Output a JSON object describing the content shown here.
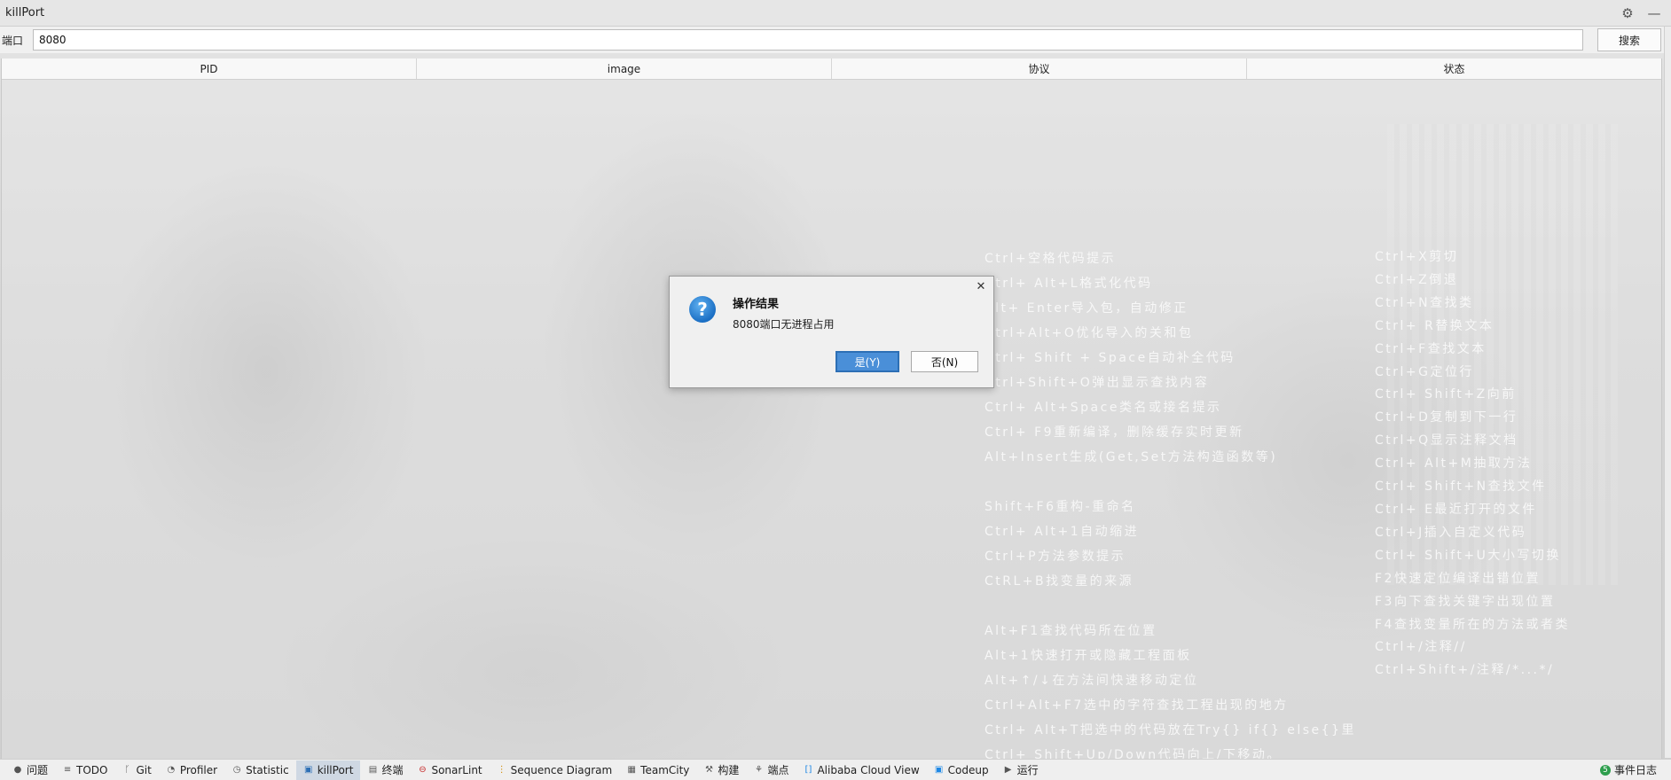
{
  "window": {
    "title": "killPort"
  },
  "titlebar_icons": [
    "gear-icon",
    "minimize-icon"
  ],
  "search": {
    "label": "端口",
    "value": "8080",
    "button": "搜索"
  },
  "table": {
    "columns": [
      "PID",
      "image",
      "协议",
      "状态"
    ],
    "rows": []
  },
  "hints_left": [
    "Ctrl+空格代码提示",
    "Ctrl+ Alt+L格式化代码",
    "Alt+ Enter导入包，自动修正",
    "Ctrl+Alt+O优化导入的关和包",
    "Ctrl+ Shift + Space自动补全代码",
    "Ctrl+Shift+O弹出显示查找内容",
    "Ctrl+ Alt+Space类名或接名提示",
    "Ctrl+ F9重新编译，删除缓存实时更新",
    "Alt+Insert生成(Get,Set方法构造函数等)",
    "",
    "Shift+F6重构-重命名",
    "Ctrl+ Alt+1自动缩进",
    "Ctrl+P方法参数提示",
    "CtRL+B找变量的来源",
    "",
    "Alt+F1查找代码所在位置",
    "Alt+1快速打开或隐藏工程面板",
    "Alt+↑/↓在方法间快速移动定位",
    "Ctrl+Alt+F7选中的字符查找工程出现的地方",
    "Ctrl+ Alt+T把选中的代码放在Try{} if{} else{}里",
    "Ctrl+ Shift+Up/Down代码向上/下移动。"
  ],
  "hints_right": [
    "Ctrl+X剪切",
    "Ctrl+Z倒退",
    "Ctrl+N查找类",
    "Ctrl+ R替换文本",
    "Ctrl+F查找文本",
    "Ctrl+G定位行",
    "Ctrl+ Shift+Z向前",
    "Ctrl+D复制到下一行",
    "Ctrl+Q显示注释文档",
    "Ctrl+ Alt+M抽取方法",
    "Ctrl+ Shift+N查找文件",
    "Ctrl+ E最近打开的文件",
    "Ctrl+J插入自定义代码",
    "Ctrl+ Shift+U大小写切换",
    "F2快速定位编译出错位置",
    "F3向下查找关键字出现位置",
    "F4查找变量所在的方法或者类",
    "Ctrl+/注释//",
    "Ctrl+Shift+/注释/*...*/"
  ],
  "dialog": {
    "title": "操作结果",
    "message": "8080端口无进程占用",
    "icon": "question-icon",
    "yes": "是(Y)",
    "no": "否(N)"
  },
  "statusbar": {
    "items": [
      {
        "label": "问题",
        "icon": "info-icon"
      },
      {
        "label": "TODO",
        "icon": "list-icon"
      },
      {
        "label": "Git",
        "icon": "branch-icon"
      },
      {
        "label": "Profiler",
        "icon": "profiler-icon"
      },
      {
        "label": "Statistic",
        "icon": "clock-icon"
      },
      {
        "label": "killPort",
        "icon": "plugin-icon",
        "active": true
      },
      {
        "label": "终端",
        "icon": "terminal-icon"
      },
      {
        "label": "SonarLint",
        "icon": "sonar-icon"
      },
      {
        "label": "Sequence Diagram",
        "icon": "sequence-icon"
      },
      {
        "label": "TeamCity",
        "icon": "teamcity-icon"
      },
      {
        "label": "构建",
        "icon": "hammer-icon"
      },
      {
        "label": "端点",
        "icon": "endpoint-icon"
      },
      {
        "label": "Alibaba Cloud View",
        "icon": "cloud-icon"
      },
      {
        "label": "Codeup",
        "icon": "codeup-icon"
      },
      {
        "label": "运行",
        "icon": "run-icon"
      }
    ],
    "event_log": {
      "label": "事件日志",
      "badge": "5"
    }
  }
}
